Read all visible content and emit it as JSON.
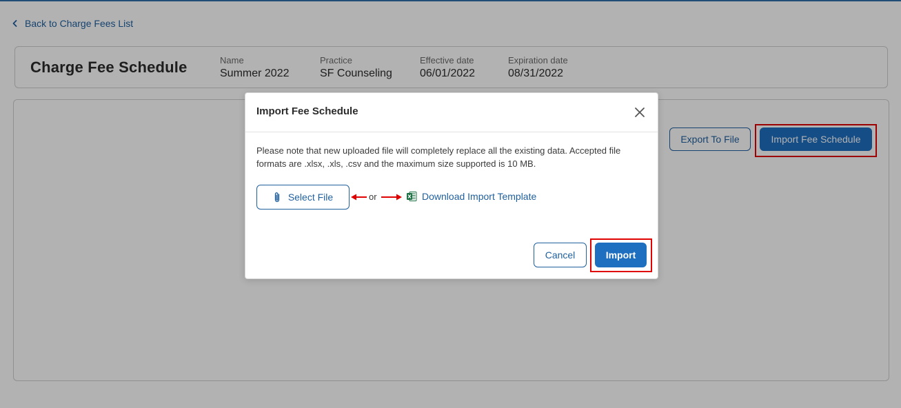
{
  "nav": {
    "back_label": "Back to Charge Fees List"
  },
  "header": {
    "title": "Charge Fee Schedule",
    "fields": [
      {
        "label": "Name",
        "value": "Summer 2022"
      },
      {
        "label": "Practice",
        "value": "SF Counseling"
      },
      {
        "label": "Effective date",
        "value": "06/01/2022"
      },
      {
        "label": "Expiration date",
        "value": "08/31/2022"
      }
    ]
  },
  "toolbar": {
    "export_label": "Export To File",
    "import_label": "Import Fee Schedule"
  },
  "modal": {
    "title": "Import Fee Schedule",
    "note": "Please note that new uploaded file will completely replace all the existing data. Accepted file formats are .xlsx, .xls, .csv and the maximum size supported is 10 MB.",
    "select_file_label": "Select File",
    "or_label": "or",
    "download_label": "Download Import Template",
    "cancel_label": "Cancel",
    "import_label": "Import"
  },
  "icons": {
    "back": "chevron-left-icon",
    "close": "close-icon",
    "attach": "paperclip-icon",
    "excel": "excel-file-icon",
    "annotation_arrow": "red-arrow-icon"
  },
  "colors": {
    "primary": "#1f6fc0",
    "link": "#1f5f9e",
    "annotation": "#e00000",
    "excel_green": "#1d7044"
  }
}
